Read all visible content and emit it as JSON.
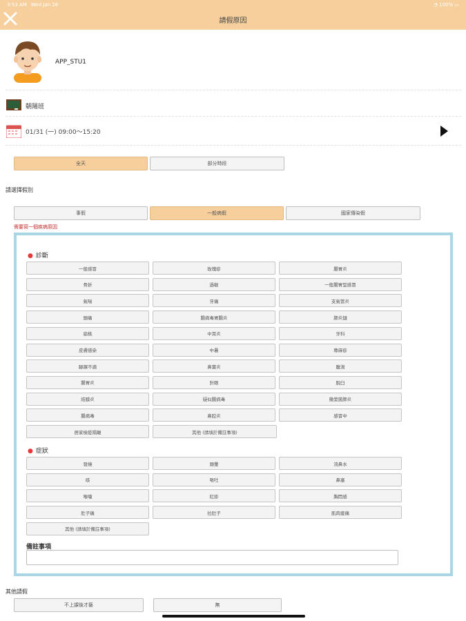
{
  "status_bar": {
    "time": "3:53 AM",
    "date": "Wed Jan 26",
    "battery": "100%"
  },
  "nav": {
    "title": "請假原因"
  },
  "profile": {
    "username": "APP_STU1"
  },
  "class_name": "朝陽班",
  "datetime": "01/31 (一) 09:00～15:20",
  "duration": {
    "full_day": "全天",
    "partial": "部分時段"
  },
  "leave_type": {
    "label": "請選擇假別",
    "options": [
      "事假",
      "一般病假",
      "國家傳染假"
    ],
    "warning": "需要寫一個疾病原因"
  },
  "diagnosis": {
    "title": "診斷",
    "items": [
      "一般感冒",
      "玫瑰疹",
      "腸胃炎",
      "骨折",
      "過敏",
      "一般腸胃型感冒",
      "氣喘",
      "牙痛",
      "支氣管炎",
      "頭痛",
      "腸病毒胃腸炎",
      "肺炎鏈",
      "扁桃",
      "中耳炎",
      "牙科",
      "皮膚感染",
      "中暑",
      "蕁麻疹",
      "腳踝不適",
      "鼻竇炎",
      "腹瀉",
      "腸胃炎",
      "針眼",
      "脫臼",
      "結膜炎",
      "疑似腸病毒",
      "黴漿菌肺炎",
      "腸病毒",
      "鼻腔炎",
      "感冒中",
      "居家檢疫隔離",
      "其他 (請填於備註事項)"
    ]
  },
  "symptoms": {
    "title": "症狀",
    "items": [
      "發燒",
      "頭暈",
      "流鼻水",
      "咳",
      "嘔吐",
      "鼻塞",
      "喉嚨",
      "紅疹",
      "胸悶感",
      "肚子痛",
      "拉肚子",
      "肌肉痠痛",
      "其他 (請填於備註事項)"
    ]
  },
  "notes": {
    "title": "備註事項",
    "value": ""
  },
  "other_leave": {
    "label": "其他請假",
    "options": [
      "不上課後才藝",
      "無"
    ]
  }
}
